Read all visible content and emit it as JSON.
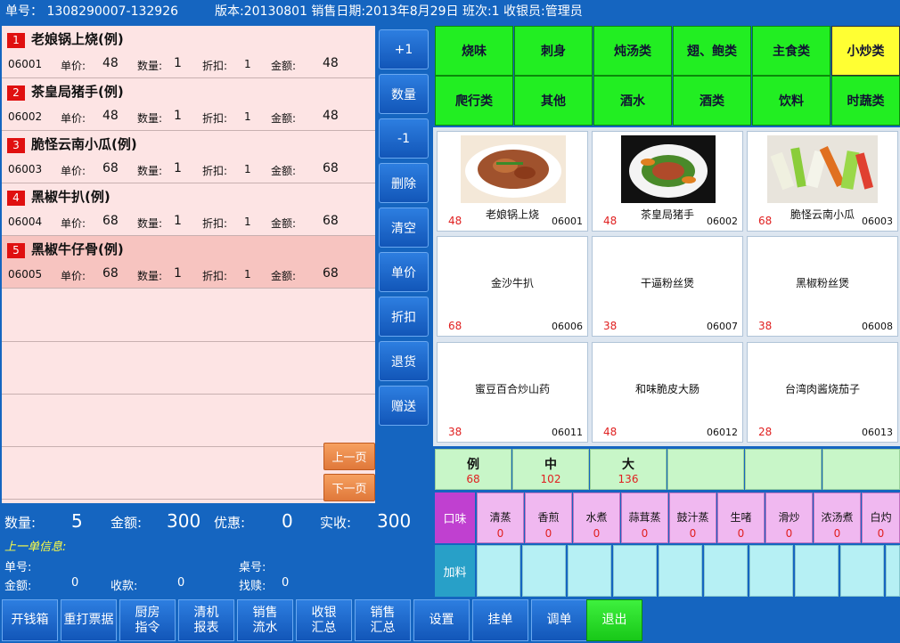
{
  "header": {
    "order_no": "单号：  1308290007-132926",
    "info": "版本:20130801 销售日期:2013年8月29日 班次:1 收银员:管理员"
  },
  "field_labels": {
    "price": "单价:",
    "qty": "数量:",
    "discount": "折扣:",
    "amount": "金额:"
  },
  "orders": [
    {
      "num": "1",
      "name": "老娘锅上烧(例)",
      "code": "06001",
      "price": "48",
      "qty": "1",
      "discount": "1",
      "amount": "48"
    },
    {
      "num": "2",
      "name": "茶皇局猪手(例)",
      "code": "06002",
      "price": "48",
      "qty": "1",
      "discount": "1",
      "amount": "48"
    },
    {
      "num": "3",
      "name": "脆怪云南小瓜(例)",
      "code": "06003",
      "price": "68",
      "qty": "1",
      "discount": "1",
      "amount": "68"
    },
    {
      "num": "4",
      "name": "黑椒牛扒(例)",
      "code": "06004",
      "price": "68",
      "qty": "1",
      "discount": "1",
      "amount": "68"
    },
    {
      "num": "5",
      "name": "黑椒牛仔骨(例)",
      "code": "06005",
      "price": "68",
      "qty": "1",
      "discount": "1",
      "amount": "68"
    }
  ],
  "mid_buttons": [
    "+1",
    "数量",
    "-1",
    "删除",
    "清空",
    "单价",
    "折扣",
    "退货",
    "赠送"
  ],
  "pager": {
    "prev": "上一页",
    "next": "下一页"
  },
  "categories": [
    "烧味",
    "刺身",
    "炖汤类",
    "翅、鲍类",
    "主食类",
    "小炒类",
    "爬行类",
    "其他",
    "酒水",
    "酒类",
    "饮料",
    "时蔬类"
  ],
  "selected_category": "小炒类",
  "dishes": [
    {
      "name": "老娘锅上烧",
      "price": "48",
      "code": "06001"
    },
    {
      "name": "茶皇局猪手",
      "price": "48",
      "code": "06002"
    },
    {
      "name": "脆怪云南小瓜",
      "price": "68",
      "code": "06003"
    },
    {
      "name": "金沙牛扒",
      "price": "68",
      "code": "06006"
    },
    {
      "name": "干逼粉丝煲",
      "price": "38",
      "code": "06007"
    },
    {
      "name": "黑椒粉丝煲",
      "price": "38",
      "code": "06008"
    },
    {
      "name": "蜜豆百合炒山药",
      "price": "38",
      "code": "06011"
    },
    {
      "name": "和味脆皮大肠",
      "price": "48",
      "code": "06012"
    },
    {
      "name": "台湾肉酱烧茄子",
      "price": "28",
      "code": "06013"
    }
  ],
  "sizes": [
    {
      "name": "例",
      "price": "68"
    },
    {
      "name": "中",
      "price": "102"
    },
    {
      "name": "大",
      "price": "136"
    }
  ],
  "flavor_label": "口味",
  "flavors": [
    {
      "name": "清蒸",
      "val": "0"
    },
    {
      "name": "香煎",
      "val": "0"
    },
    {
      "name": "水煮",
      "val": "0"
    },
    {
      "name": "蒜茸蒸",
      "val": "0"
    },
    {
      "name": "鼓汁蒸",
      "val": "0"
    },
    {
      "name": "生啫",
      "val": "0"
    },
    {
      "name": "滑炒",
      "val": "0"
    },
    {
      "name": "浓汤煮",
      "val": "0"
    },
    {
      "name": "白灼",
      "val": "0"
    }
  ],
  "addon_label": "加料",
  "summary": {
    "qty_label": "数量:",
    "qty": "5",
    "amount_label": "金额:",
    "amount": "300",
    "discount_label": "优惠:",
    "discount": "0",
    "paid_label": "实收:",
    "paid": "300",
    "last_title": "上一单信息:",
    "last_no_label": "单号:",
    "table_label": "桌号:",
    "last_amount_label": "金额:",
    "last_amount": "0",
    "received_label": "收款:",
    "received": "0",
    "change_label": "找赎:",
    "change": "0"
  },
  "bottom_buttons": [
    "开钱箱",
    "重打票据",
    "厨房指令",
    "清机报表",
    "销售流水",
    "收银汇总",
    "销售汇总",
    "设置",
    "挂单",
    "调单",
    "退出"
  ],
  "colors": {
    "bg": "#1565c0",
    "category": "#22ee22",
    "selected_category": "#ffff33",
    "price": "#e02020",
    "exit": "#22dd22"
  }
}
